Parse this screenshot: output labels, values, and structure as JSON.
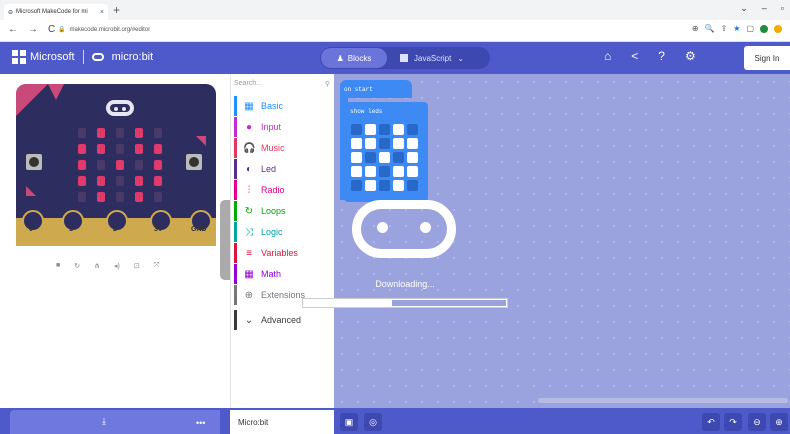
{
  "browser": {
    "tab_title": "Microsoft MakeCode for mi",
    "tab_close": "×",
    "new_tab": "+",
    "window_controls": [
      "⌄",
      "–",
      "▫"
    ],
    "nav": [
      "←",
      "→",
      "C"
    ],
    "lock": "🔒",
    "url": "makecode.microbit.org/#editor",
    "icons": [
      "⊕",
      "🔍",
      "⇪",
      "★",
      "▢"
    ]
  },
  "header": {
    "microsoft": "Microsoft",
    "product": "micro:bit",
    "blocks_label": "Blocks",
    "js_label": "JavaScript",
    "js_caret": "⌄",
    "signin": "Sign In"
  },
  "simulator": {
    "pins": [
      "0",
      "1",
      "2",
      "3V",
      "GND"
    ],
    "tools": [
      "■",
      "↻",
      "⋔",
      "◂)",
      "⊡",
      "⤧"
    ],
    "led_grid": [
      [
        0,
        1,
        0,
        1,
        0
      ],
      [
        1,
        1,
        0,
        1,
        1
      ],
      [
        1,
        0,
        1,
        0,
        1
      ],
      [
        1,
        1,
        0,
        1,
        1
      ],
      [
        0,
        1,
        0,
        1,
        0
      ]
    ]
  },
  "toolbox": {
    "search_placeholder": "Search...",
    "categories": [
      {
        "label": "Basic",
        "color": "#1e90ff",
        "icon": "▦"
      },
      {
        "label": "Input",
        "color": "#c02dd1",
        "icon": "●"
      },
      {
        "label": "Music",
        "color": "#e2385d",
        "icon": "🎧"
      },
      {
        "label": "Led",
        "color": "#5c2d91",
        "icon": "◐"
      },
      {
        "label": "Radio",
        "color": "#e3008c",
        "icon": "⫶"
      },
      {
        "label": "Loops",
        "color": "#00aa00",
        "icon": "↻"
      },
      {
        "label": "Logic",
        "color": "#00a4a6",
        "icon": "⤨"
      },
      {
        "label": "Variables",
        "color": "#dc143c",
        "icon": "≡"
      },
      {
        "label": "Math",
        "color": "#9400d3",
        "icon": "▦"
      },
      {
        "label": "Extensions",
        "color": "#777777",
        "icon": "⊕"
      },
      {
        "label": "Advanced",
        "color": "#3c3c3c",
        "icon": "⌄"
      }
    ]
  },
  "workspace": {
    "on_start": "on start",
    "show_leds": "show leds",
    "leds": [
      [
        0,
        1,
        0,
        1,
        0
      ],
      [
        1,
        1,
        0,
        1,
        1
      ],
      [
        1,
        0,
        1,
        0,
        1
      ],
      [
        1,
        1,
        0,
        1,
        1
      ],
      [
        0,
        1,
        0,
        1,
        0
      ]
    ],
    "downloading": "Downloading...",
    "progress": 0.43
  },
  "bottombar": {
    "more": "•••",
    "project_name": "Micro:bit",
    "save_icon": "▣",
    "github_icon": "◎",
    "undo": "↶",
    "redo": "↷",
    "zoom_out": "⊖",
    "zoom_in": "⊕"
  }
}
